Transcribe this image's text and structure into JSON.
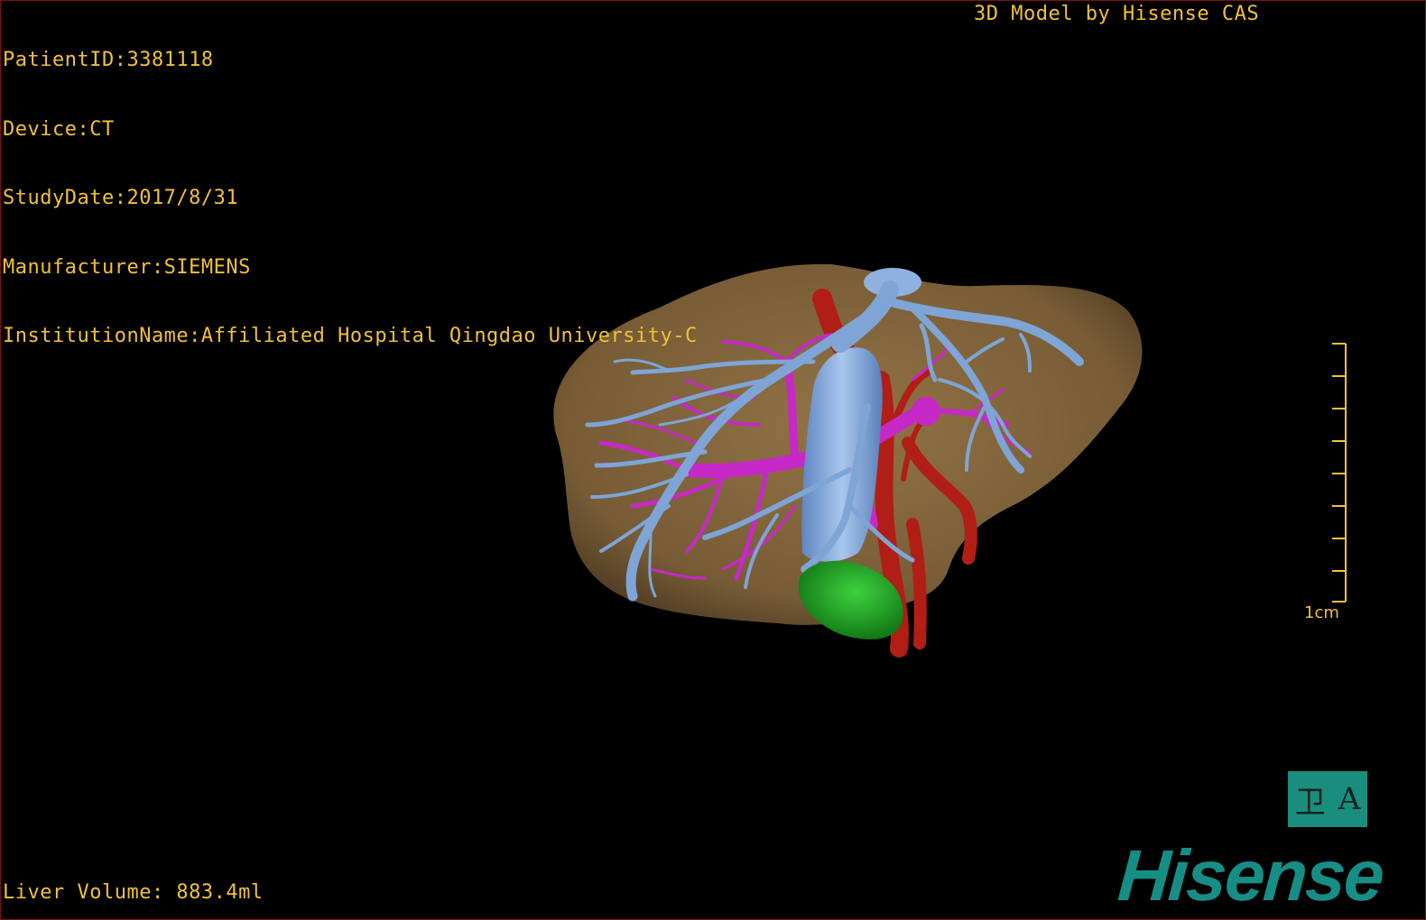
{
  "overlay": {
    "patient_id": "PatientID:3381118",
    "device": "Device:CT",
    "study_date": "StudyDate:2017/8/31",
    "manufacturer": "Manufacturer:SIEMENS",
    "institution": "InstitutionName:Affiliated Hospital Qingdao University-C",
    "title_right": "3D Model by Hisense CAS",
    "liver_volume": "Liver Volume: 883.4ml"
  },
  "scale_bar": {
    "label": "1cm"
  },
  "orientation": {
    "left_glyph": "卫",
    "right_glyph": "A"
  },
  "brand": {
    "logo_text": "Hisense"
  },
  "colors": {
    "overlay_text": "#f0c13a",
    "liver": "#8a6a3e",
    "hepatic_vein": "#7fa4d6",
    "portal_vein": "#c629c6",
    "artery": "#b01e16",
    "gallbladder": "#1e9a26",
    "brand": "#168e86"
  }
}
